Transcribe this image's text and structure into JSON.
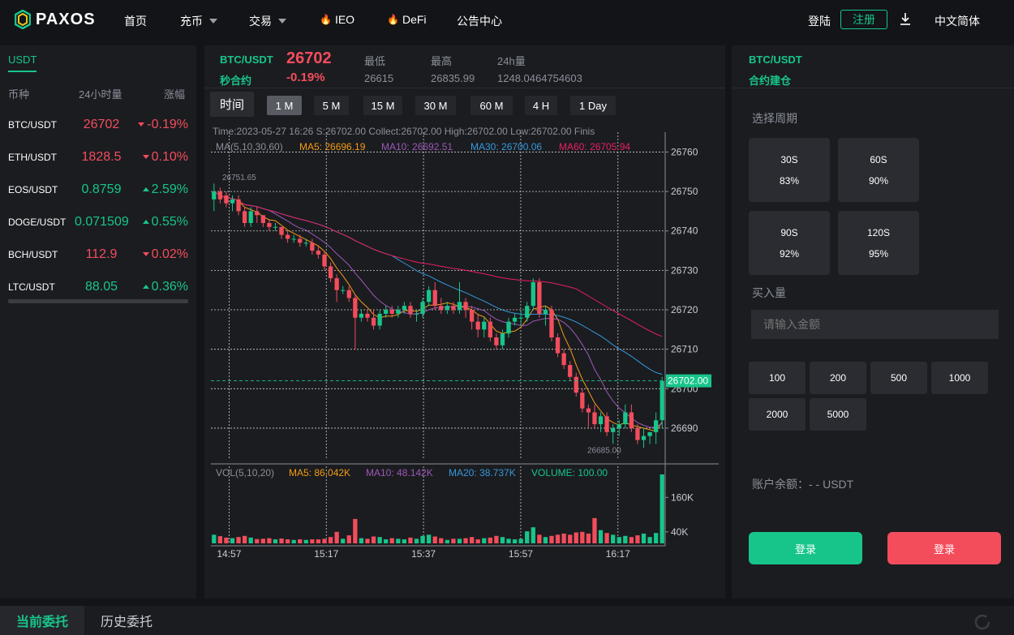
{
  "nav": {
    "brand": "PAXOS",
    "home": "首页",
    "deposit": "充币",
    "trade": "交易",
    "ieo": "IEO",
    "defi": "DeFi",
    "notice": "公告中心",
    "login": "登陆",
    "register": "注册",
    "language": "中文简体"
  },
  "market": {
    "tab": "USDT",
    "headers": {
      "symbol": "币种",
      "volume": "24小时量",
      "change": "涨幅"
    },
    "rows": [
      {
        "symbol": "BTC/USDT",
        "price": "26702",
        "change": "-0.19%",
        "dir": "down"
      },
      {
        "symbol": "ETH/USDT",
        "price": "1828.5",
        "change": "0.10%",
        "dir": "down"
      },
      {
        "symbol": "EOS/USDT",
        "price": "0.8759",
        "change": "2.59%",
        "dir": "up"
      },
      {
        "symbol": "DOGE/USDT",
        "price": "0.071509",
        "change": "0.55%",
        "dir": "up"
      },
      {
        "symbol": "BCH/USDT",
        "price": "112.9",
        "change": "0.02%",
        "dir": "down"
      },
      {
        "symbol": "LTC/USDT",
        "price": "88.05",
        "change": "0.36%",
        "dir": "up"
      }
    ]
  },
  "ticker": {
    "pair": "BTC/USDT",
    "contract": "秒合约",
    "price": "26702",
    "change": "-0.19%",
    "low_label": "最低",
    "low": "26615",
    "high_label": "最高",
    "high": "26835.99",
    "vol_label": "24h量",
    "vol": "1248.0464754603"
  },
  "timeframes": {
    "time": "时间",
    "items": [
      "1 M",
      "5 M",
      "15 M",
      "30 M",
      "60 M",
      "4 H",
      "1 Day"
    ],
    "active": "1 M"
  },
  "chart_info": {
    "line1": "Time:2023-05-27 16:26    S:26702.00    Collect:26702.00    High:26702.00    Low:26702.00   Finis",
    "ma_label": "MA(5,10,30,60)",
    "ma5": "MA5: 26696.19",
    "ma10": "MA10: 26692.51",
    "ma30": "MA30: 26700.06",
    "ma60": "MA60: 26705.94",
    "max_mark": "26751.65",
    "min_mark": "26685.00",
    "last_price": "26702.00",
    "vol_label": "VOL(5,10,20)",
    "vol_ma5": "MA5: 86.042K",
    "vol_ma10": "MA10: 48.142K",
    "vol_ma20": "MA20: 38.737K",
    "volume": "VOLUME: 100.00"
  },
  "colors": {
    "up": "#17c58a",
    "down": "#f34d5c",
    "ma5": "#f39c12",
    "ma10": "#9b59b6",
    "ma30": "#3498db",
    "ma60": "#e91e63"
  },
  "chart_data": {
    "type": "candlestick",
    "x_ticks": [
      "14:57",
      "15:17",
      "15:37",
      "15:57",
      "16:17"
    ],
    "y_ticks": [
      26760,
      26750,
      26740,
      26730,
      26720,
      26710,
      26700,
      26690
    ],
    "ylim": [
      26683,
      26764
    ],
    "vol_ticks": [
      "160K",
      "40K"
    ],
    "vol_tick_values": [
      160000,
      40000
    ],
    "vol_max": 240000,
    "candles": [
      [
        26748,
        26752,
        26745,
        26750,
        30000
      ],
      [
        26750,
        26751,
        26747,
        26748,
        25000
      ],
      [
        26749,
        26750,
        26746,
        26747,
        20000
      ],
      [
        26747,
        26749,
        26745,
        26748,
        18000
      ],
      [
        26748,
        26749,
        26744,
        26745,
        22000
      ],
      [
        26745,
        26746,
        26741,
        26742,
        26000
      ],
      [
        26742,
        26746,
        26741,
        26745,
        20000
      ],
      [
        26745,
        26746,
        26742,
        26744,
        15000
      ],
      [
        26744,
        26744,
        26741,
        26742,
        16000
      ],
      [
        26742,
        26743,
        26740,
        26741,
        18000
      ],
      [
        26741,
        26742,
        26740,
        26741,
        14000
      ],
      [
        26741,
        26741,
        26738,
        26739,
        17000
      ],
      [
        26739,
        26740,
        26737,
        26738,
        14000
      ],
      [
        26738,
        26739,
        26737,
        26738,
        12000
      ],
      [
        26738,
        26739,
        26736,
        26737,
        14000
      ],
      [
        26737,
        26738,
        26736,
        26737,
        12000
      ],
      [
        26737,
        26738,
        26734,
        26735,
        14000
      ],
      [
        26735,
        26736,
        26733,
        26734,
        14000
      ],
      [
        26734,
        26735,
        26730,
        26731,
        16000
      ],
      [
        26731,
        26732,
        26727,
        26728,
        22000
      ],
      [
        26728,
        26729,
        26722,
        26725,
        40000
      ],
      [
        26725,
        26726,
        26724,
        26725,
        16000
      ],
      [
        26725,
        26726,
        26722,
        26723,
        28000
      ],
      [
        26723,
        26724,
        26710,
        26718,
        85000
      ],
      [
        26718,
        26720,
        26717,
        26719,
        18000
      ],
      [
        26719,
        26720,
        26717,
        26718,
        16000
      ],
      [
        26718,
        26720,
        26715,
        26716,
        24000
      ],
      [
        26716,
        26720,
        26715,
        26719,
        22000
      ],
      [
        26719,
        26721,
        26718,
        26720,
        14000
      ],
      [
        26720,
        26721,
        26718,
        26719,
        18000
      ],
      [
        26719,
        26721,
        26718,
        26720,
        16000
      ],
      [
        26720,
        26722,
        26719,
        26721,
        14000
      ],
      [
        26721,
        26722,
        26718,
        26719,
        20000
      ],
      [
        26719,
        26720,
        26717,
        26719,
        16000
      ],
      [
        26719,
        26723,
        26718,
        26722,
        26000
      ],
      [
        26722,
        26726,
        26721,
        26725,
        30000
      ],
      [
        26725,
        26727,
        26720,
        26721,
        24000
      ],
      [
        26721,
        26723,
        26719,
        26720,
        18000
      ],
      [
        26720,
        26722,
        26719,
        26721,
        12000
      ],
      [
        26721,
        26722,
        26719,
        26720,
        16000
      ],
      [
        26720,
        26727,
        26719,
        26722,
        16000
      ],
      [
        26722,
        26723,
        26718,
        26720,
        18000
      ],
      [
        26720,
        26721,
        26715,
        26717,
        22000
      ],
      [
        26717,
        26719,
        26713,
        26715,
        14000
      ],
      [
        26715,
        26718,
        26713,
        26717,
        18000
      ],
      [
        26717,
        26718,
        26712,
        26713,
        20000
      ],
      [
        26713,
        26714,
        26710,
        26711,
        26000
      ],
      [
        26711,
        26715,
        26710,
        26714,
        22000
      ],
      [
        26714,
        26718,
        26713,
        26717,
        16000
      ],
      [
        26717,
        26719,
        26716,
        26718,
        14000
      ],
      [
        26718,
        26720,
        26716,
        26718,
        16000
      ],
      [
        26718,
        26722,
        26717,
        26721,
        42000
      ],
      [
        26721,
        26728,
        26720,
        26727,
        56000
      ],
      [
        26727,
        26728,
        26718,
        26719,
        30000
      ],
      [
        26719,
        26721,
        26716,
        26720,
        22000
      ],
      [
        26720,
        26721,
        26712,
        26713,
        26000
      ],
      [
        26713,
        26714,
        26708,
        26709,
        30000
      ],
      [
        26709,
        26710,
        26705,
        26706,
        34000
      ],
      [
        26706,
        26707,
        26702,
        26703,
        30000
      ],
      [
        26703,
        26704,
        26698,
        26699,
        38000
      ],
      [
        26699,
        26700,
        26694,
        26695,
        40000
      ],
      [
        26695,
        26696,
        26690,
        26694,
        34000
      ],
      [
        26694,
        26696,
        26690,
        26691,
        88000
      ],
      [
        26691,
        26694,
        26689,
        26693,
        46000
      ],
      [
        26693,
        26694,
        26688,
        26689,
        36000
      ],
      [
        26689,
        26691,
        26686,
        26690,
        30000
      ],
      [
        26690,
        26692,
        26688,
        26691,
        22000
      ],
      [
        26691,
        26696,
        26690,
        26694,
        26000
      ],
      [
        26694,
        26696,
        26689,
        26690,
        22000
      ],
      [
        26690,
        26691,
        26686,
        26687,
        28000
      ],
      [
        26687,
        26690,
        26685,
        26688,
        34000
      ],
      [
        26688,
        26689,
        26686,
        26689,
        22000
      ],
      [
        26689,
        26694,
        26686,
        26692,
        36000
      ],
      [
        26692,
        26703,
        26690,
        26702,
        240000
      ]
    ]
  },
  "order": {
    "pair": "BTC/USDT",
    "title": "合约建仓",
    "period_label": "选择周期",
    "periods": [
      {
        "time": "30S",
        "rate": "83%"
      },
      {
        "time": "60S",
        "rate": "90%"
      },
      {
        "time": "90S",
        "rate": "92%"
      },
      {
        "time": "120S",
        "rate": "95%"
      }
    ],
    "amount_label": "买入量",
    "amount_placeholder": "请输入金额",
    "amounts": [
      "100",
      "200",
      "500",
      "1000",
      "2000",
      "5000"
    ],
    "balance": "账户余额：- - USDT",
    "buy_up": "登录",
    "buy_down": "登录"
  },
  "bottom": {
    "tab_current": "当前委托",
    "tab_history": "历史委托"
  }
}
